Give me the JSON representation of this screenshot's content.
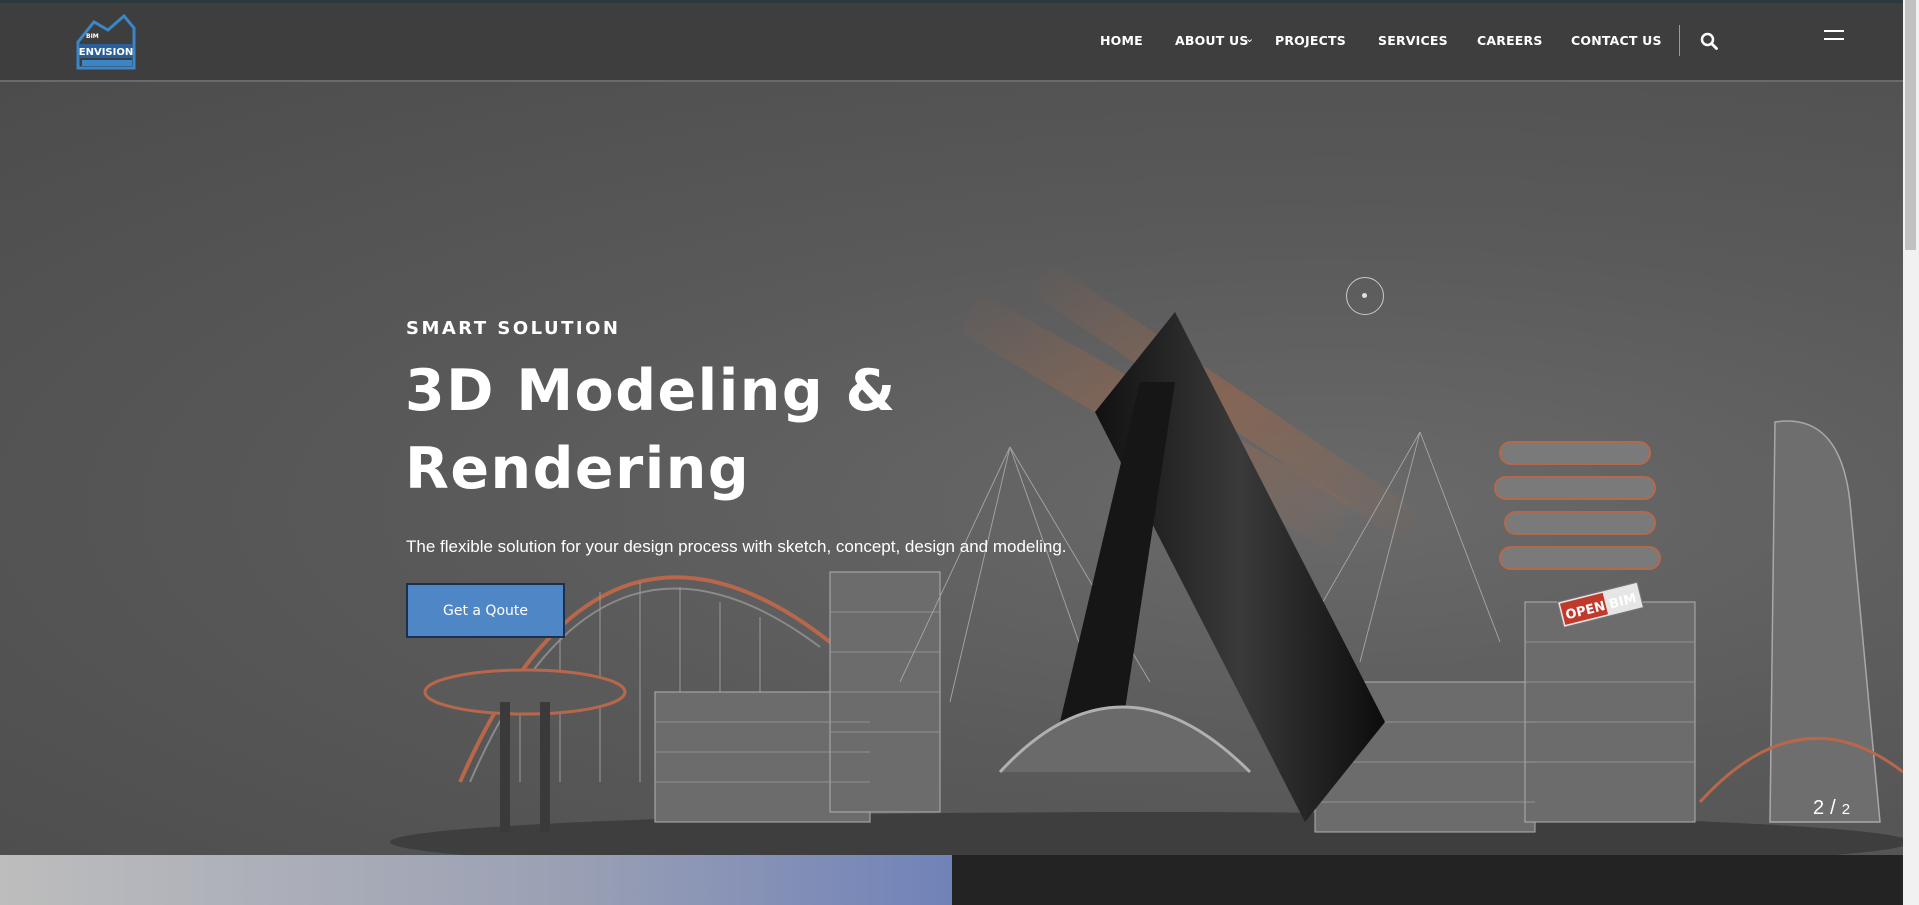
{
  "brand": {
    "logo_text": "ENVISION",
    "logo_sub": "BIM"
  },
  "nav": {
    "home": "HOME",
    "about": "ABOUT US",
    "projects": "PROJECTS",
    "services": "SERVICES",
    "careers": "CAREERS",
    "contact": "CONTACT US"
  },
  "hero": {
    "kicker": "SMART SOLUTION",
    "headline": "3D Modeling & Rendering",
    "description": "The flexible solution for your design process with sketch, concept, design and modeling.",
    "cta": "Get a Qoute",
    "sign_text": "OPEN BIM"
  },
  "slider": {
    "current": "2",
    "separator": "/",
    "total": "2"
  },
  "colors": {
    "accent": "#4f86c6",
    "header": "#3e3e3e",
    "logo_blue": "#3a86c8",
    "sign_red": "#c0392b"
  },
  "icons": {
    "search": "search-icon",
    "menu": "hamburger-menu-icon",
    "dropdown": "chevron-down-icon"
  }
}
